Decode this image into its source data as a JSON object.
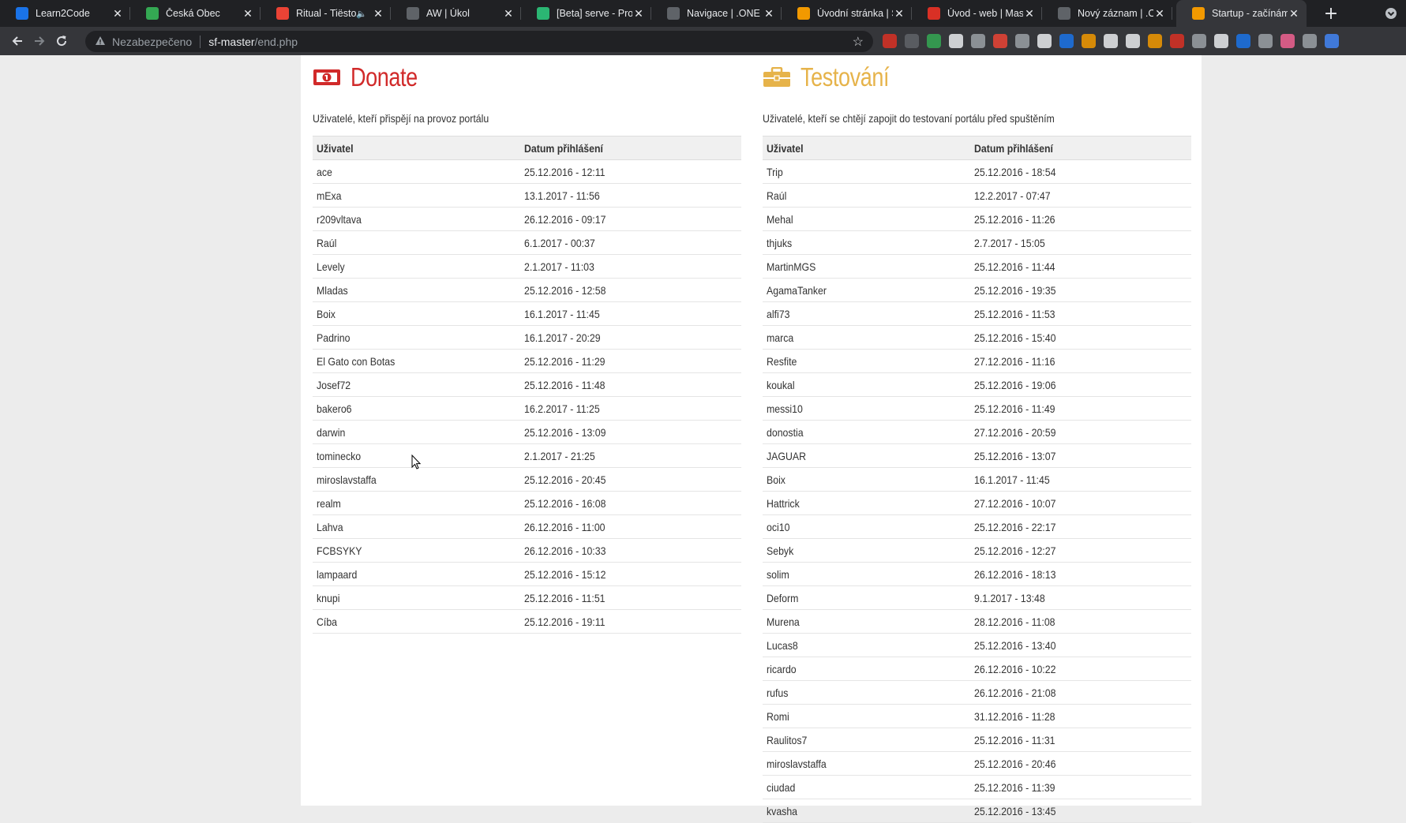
{
  "browser": {
    "tabs": [
      {
        "title": "Learn2Code",
        "favicon_color": "#1a73e8",
        "icon": "learn2code-icon"
      },
      {
        "title": "Česká Obec",
        "favicon_color": "#34a853",
        "icon": "ceska-obec-icon"
      },
      {
        "title": "Ritual - Tiësto,",
        "favicon_color": "#ea4335",
        "icon": "youtube-music-icon",
        "audio": true
      },
      {
        "title": "AW | Úkol",
        "favicon_color": "#5f6368",
        "icon": "globe-icon"
      },
      {
        "title": "[Beta] serve - Proje",
        "favicon_color": "#2bb673",
        "icon": "vue-icon"
      },
      {
        "title": "Navigace | .ONE",
        "favicon_color": "#5f6368",
        "icon": "globe-icon"
      },
      {
        "title": "Úvodní stránka | Šp",
        "favicon_color": "#f29900",
        "icon": "symfony-icon"
      },
      {
        "title": "Úvod - web | Maso",
        "favicon_color": "#d93025",
        "icon": "bookmark-icon"
      },
      {
        "title": "Nový záznam | .ON",
        "favicon_color": "#5f6368",
        "icon": "globe-icon"
      },
      {
        "title": "Startup - začínáme",
        "favicon_color": "#f29900",
        "icon": "symfony-icon",
        "active": true
      }
    ],
    "nav": {
      "security_label": "Nezabezpečeno",
      "url_host": "sf-master",
      "url_path": "/end.php"
    },
    "extensions": [
      "#d93025",
      "#5f6368",
      "#34a853",
      "#e8eaed",
      "#9aa0a6",
      "#ea4335",
      "#9aa0a6",
      "#e8eaed",
      "#1a73e8",
      "#f29900",
      "#e8eaed",
      "#e8eaed",
      "#f29900",
      "#d93025",
      "#9aa0a6",
      "#e8eaed",
      "#1a73e8",
      "#9aa0a6",
      "#f06292",
      "#9aa0a6",
      "#4285f4"
    ]
  },
  "donate": {
    "title": "Donate",
    "description": "Uživatelé, kteří přispějí na provoz portálu",
    "columns": [
      "Uživatel",
      "Datum přihlášení"
    ],
    "rows": [
      [
        "ace",
        "25.12.2016 - 12:11"
      ],
      [
        "mExa",
        "13.1.2017 - 11:56"
      ],
      [
        "r209vltava",
        "26.12.2016 - 09:17"
      ],
      [
        "Raúl",
        "6.1.2017 - 00:37"
      ],
      [
        "Levely",
        "2.1.2017 - 11:03"
      ],
      [
        "Mladas",
        "25.12.2016 - 12:58"
      ],
      [
        "Boix",
        "16.1.2017 - 11:45"
      ],
      [
        "Padrino",
        "16.1.2017 - 20:29"
      ],
      [
        "El Gato con Botas",
        "25.12.2016 - 11:29"
      ],
      [
        "Josef72",
        "25.12.2016 - 11:48"
      ],
      [
        "bakero6",
        "16.2.2017 - 11:25"
      ],
      [
        "darwin",
        "25.12.2016 - 13:09"
      ],
      [
        "tominecko",
        "2.1.2017 - 21:25"
      ],
      [
        "miroslavstaffa",
        "25.12.2016 - 20:45"
      ],
      [
        "realm",
        "25.12.2016 - 16:08"
      ],
      [
        "Lahva",
        "26.12.2016 - 11:00"
      ],
      [
        "FCBSYKY",
        "26.12.2016 - 10:33"
      ],
      [
        "lampaard",
        "25.12.2016 - 15:12"
      ],
      [
        "knupi",
        "25.12.2016 - 11:51"
      ],
      [
        "Cíba",
        "25.12.2016 - 19:11"
      ]
    ]
  },
  "testing": {
    "title": "Testování",
    "description": "Uživatelé, kteří se chtějí zapojit do testovaní portálu před spuštěním",
    "columns": [
      "Uživatel",
      "Datum přihlášení"
    ],
    "rows": [
      [
        "Trip",
        "25.12.2016 - 18:54"
      ],
      [
        "Raúl",
        "12.2.2017 - 07:47"
      ],
      [
        "Mehal",
        "25.12.2016 - 11:26"
      ],
      [
        "thjuks",
        "2.7.2017 - 15:05"
      ],
      [
        "MartinMGS",
        "25.12.2016 - 11:44"
      ],
      [
        "AgamaTanker",
        "25.12.2016 - 19:35"
      ],
      [
        "alfi73",
        "25.12.2016 - 11:53"
      ],
      [
        "marca",
        "25.12.2016 - 15:40"
      ],
      [
        "Resfite",
        "27.12.2016 - 11:16"
      ],
      [
        "koukal",
        "25.12.2016 - 19:06"
      ],
      [
        "messi10",
        "25.12.2016 - 11:49"
      ],
      [
        "donostia",
        "27.12.2016 - 20:59"
      ],
      [
        "JAGUAR",
        "25.12.2016 - 13:07"
      ],
      [
        "Boix",
        "16.1.2017 - 11:45"
      ],
      [
        "Hattrick",
        "27.12.2016 - 10:07"
      ],
      [
        "oci10",
        "25.12.2016 - 22:17"
      ],
      [
        "Sebyk",
        "25.12.2016 - 12:27"
      ],
      [
        "solim",
        "26.12.2016 - 18:13"
      ],
      [
        "Deform",
        "9.1.2017 - 13:48"
      ],
      [
        "Murena",
        "28.12.2016 - 11:08"
      ],
      [
        "Lucas8",
        "25.12.2016 - 13:40"
      ],
      [
        "ricardo",
        "26.12.2016 - 10:22"
      ],
      [
        "rufus",
        "26.12.2016 - 21:08"
      ],
      [
        "Romi",
        "31.12.2016 - 11:28"
      ],
      [
        "Raulitos7",
        "25.12.2016 - 11:31"
      ],
      [
        "miroslavstaffa",
        "25.12.2016 - 20:46"
      ],
      [
        "ciudad",
        "25.12.2016 - 11:39"
      ],
      [
        "kvasha",
        "25.12.2016 - 13:45"
      ]
    ]
  },
  "colors": {
    "donate_accent": "#d12a2a",
    "testing_accent": "#e6b34a",
    "page_bg": "#ececec"
  }
}
